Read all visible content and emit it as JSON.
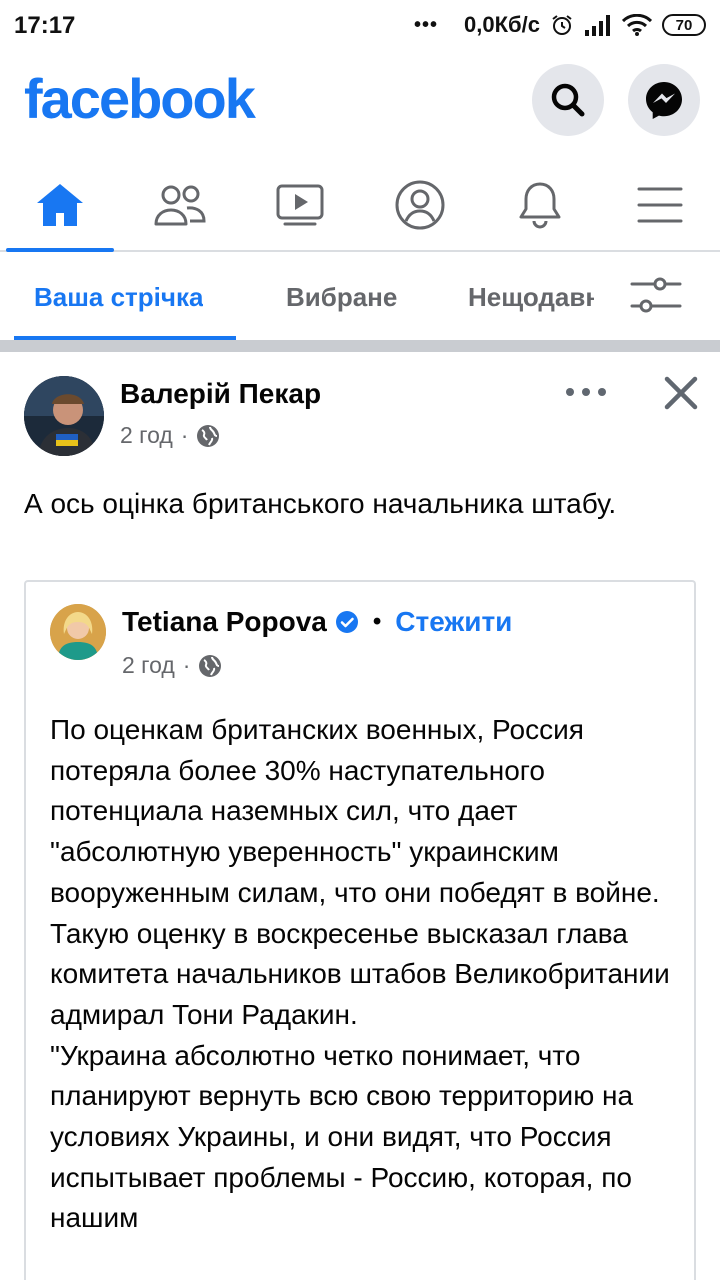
{
  "status_bar": {
    "time": "17:17",
    "dots": "•••",
    "speed": "0,0Кб/с",
    "battery": "70"
  },
  "header": {
    "logo": "facebook",
    "search_icon": "search-icon",
    "messenger_icon": "messenger-icon"
  },
  "nav": {
    "items": [
      "home-icon",
      "friends-icon",
      "watch-icon",
      "profile-icon",
      "notifications-icon",
      "menu-icon"
    ],
    "active": "home"
  },
  "tabs": {
    "items": [
      {
        "label": "Ваша стрічка"
      },
      {
        "label": "Вибране"
      },
      {
        "label": "Нещодавні"
      }
    ],
    "filter_icon": "filter-icon"
  },
  "post": {
    "author": "Валерій Пекар",
    "time": "2 год",
    "meta_sep": "·",
    "text": "А ось оцінка британського начальника штабу.",
    "shared": {
      "author": "Tetiana Popova",
      "follow_sep": "•",
      "follow": "Стежити",
      "time": "2 год",
      "meta_sep": "·",
      "paragraphs": [
        "По оценкам британских военных, Россия потеряла более 30% наступательного потенциала наземных сил, что дает \"абсолютную уверенность\" украинским вооруженным силам, что они победят в войне.",
        "Такую оценку в воскресенье высказал глава комитета начальников штабов Великобритании адмирал Тони Радакин.",
        "\"Украина абсолютно четко понимает, что планируют вернуть всю свою территорию на условиях Украины, и они видят, что Россия испытывает проблемы - Россию, которая, по нашим"
      ]
    }
  },
  "colors": {
    "brand": "#1877f2",
    "secondary_text": "#65676b"
  }
}
